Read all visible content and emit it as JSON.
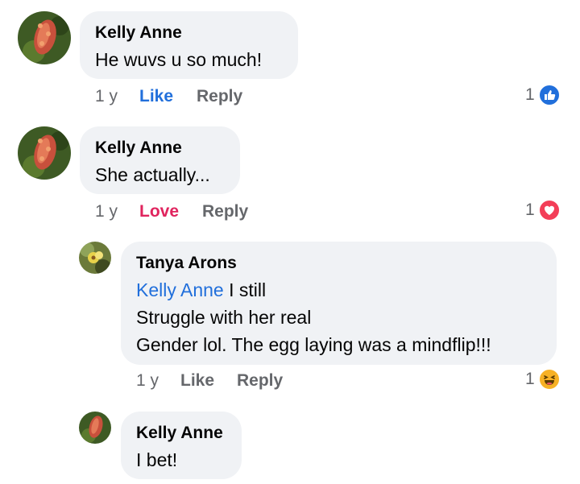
{
  "comments": [
    {
      "author": "Kelly Anne",
      "text": "He wuvs u so much!",
      "time": "1 y",
      "like_label": "Like",
      "reply_label": "Reply",
      "reaction_count": "1",
      "reaction_icon": "like-reaction-icon"
    },
    {
      "author": "Kelly Anne",
      "text": "She actually...",
      "time": "1 y",
      "like_label": "Love",
      "reply_label": "Reply",
      "reaction_count": "1",
      "reaction_icon": "love-reaction-icon"
    },
    {
      "author": "Tanya Arons",
      "mention": "Kelly Anne",
      "line1_rest": " I still",
      "line2": "Struggle with her real",
      "line3": "Gender lol.  The egg laying was a mindflip!!!",
      "time": "1 y",
      "like_label": "Like",
      "reply_label": "Reply",
      "reaction_count": "1",
      "reaction_icon": "haha-reaction-icon"
    },
    {
      "author": "Kelly Anne",
      "text": "I bet!"
    }
  ],
  "colors": {
    "bubble": "#f0f2f5",
    "like_blue": "#216fdb",
    "love_red": "#e0245e",
    "meta_gray": "#65676b"
  }
}
